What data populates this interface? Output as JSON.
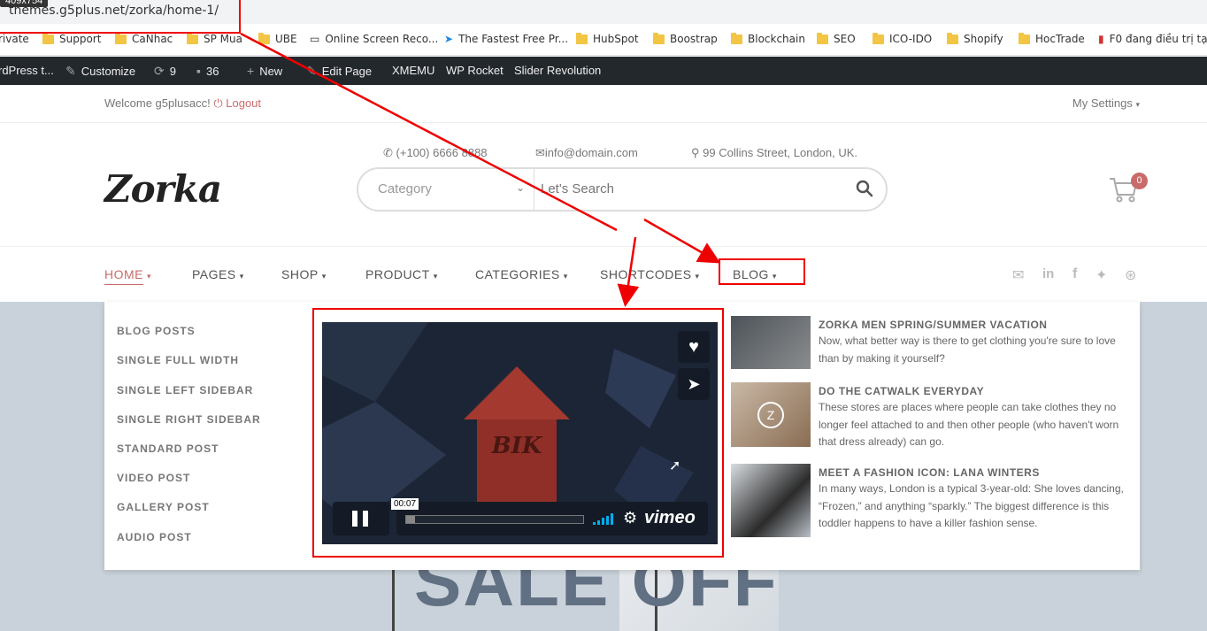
{
  "browser": {
    "url": "themes.g5plus.net/zorka/home-1/",
    "size_tip": "409x754",
    "bookmarks": [
      "rivate",
      "Support",
      "CaNhac",
      "SP Mua",
      "UBE",
      "Online Screen Reco...",
      "The Fastest Free Pr...",
      "HubSpot",
      "Boostrap",
      "Blockchain",
      "SEO",
      "ICO-IDO",
      "Shopify",
      "HocTrade",
      "F0 đang điều trị tại..."
    ]
  },
  "adminbar": {
    "site": "rdPress t...",
    "customize": "Customize",
    "updates": "9",
    "comments": "36",
    "new": "New",
    "edit": "Edit Page",
    "xmemu": "XMEMU",
    "rocket": "WP Rocket",
    "slider": "Slider Revolution"
  },
  "topbar": {
    "welcome": "Welcome g5plusacc!",
    "logout": "Logout",
    "settings": "My Settings"
  },
  "header": {
    "phone": "(+100) 6666 8888",
    "email": "info@domain.com",
    "address": "99 Collins Street, London, UK.",
    "logo": "Zorka",
    "category": "Category",
    "search_placeholder": "Let's Search",
    "cart_count": "0"
  },
  "nav": {
    "items": [
      "HOME",
      "PAGES",
      "SHOP",
      "PRODUCT",
      "CATEGORIES",
      "SHORTCODES",
      "BLOG"
    ]
  },
  "mega": {
    "links": [
      "BLOG POSTS",
      "SINGLE FULL WIDTH",
      "SINGLE LEFT SIDEBAR",
      "SINGLE RIGHT SIDEBAR",
      "STANDARD POST",
      "VIDEO POST",
      "GALLERY POST",
      "AUDIO POST"
    ],
    "video": {
      "time": "00:07",
      "brand": "vimeo",
      "house_text": "BIK",
      "progress": 0.03
    },
    "posts": [
      {
        "title": "ZORKA MEN SPRING/SUMMER VACATION",
        "body": "Now, what better way is there to get clothing you're sure to love than by making it yourself?"
      },
      {
        "title": "DO THE CATWALK EVERYDAY",
        "body": "These stores are places where people can take clothes they no longer feel attached to and then other people (who haven't worn that dress already) can go."
      },
      {
        "title": "MEET A FASHION ICON: LANA WINTERS",
        "body": "In many ways, London is a typical 3-year-old: She loves dancing, “Frozen,” and anything “sparkly.” The biggest difference is this toddler happens to have a killer fashion sense."
      }
    ]
  },
  "hero": {
    "text": "SALE OFF"
  }
}
